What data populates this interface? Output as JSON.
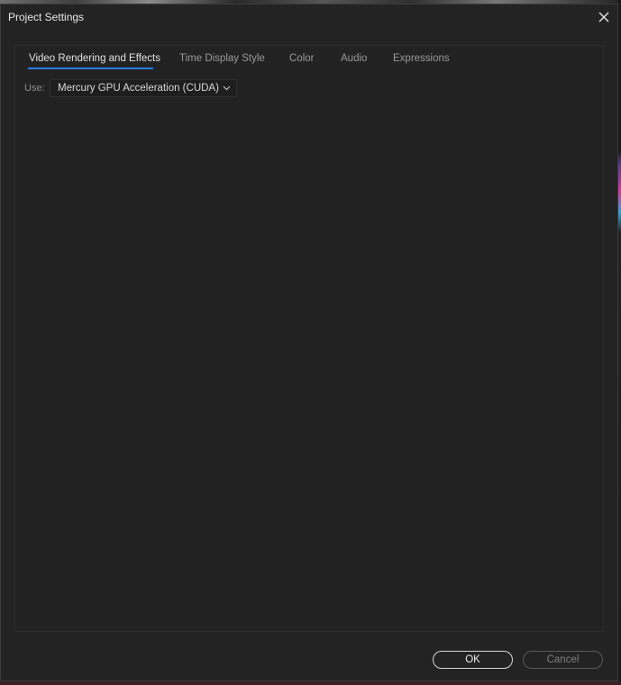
{
  "dialog": {
    "title": "Project Settings"
  },
  "tabs": [
    {
      "label": "Video Rendering and Effects",
      "active": true
    },
    {
      "label": "Time Display Style",
      "active": false
    },
    {
      "label": "Color",
      "active": false
    },
    {
      "label": "Audio",
      "active": false
    },
    {
      "label": "Expressions",
      "active": false
    }
  ],
  "renderer": {
    "label": "Use:",
    "value": "Mercury GPU Acceleration (CUDA)"
  },
  "footer": {
    "ok_label": "OK",
    "cancel_label": "Cancel"
  },
  "colors": {
    "accent": "#2680eb",
    "dialog_bg": "#232323"
  },
  "icons": {
    "close": "close-icon",
    "dropdown": "chevron-down-icon"
  }
}
